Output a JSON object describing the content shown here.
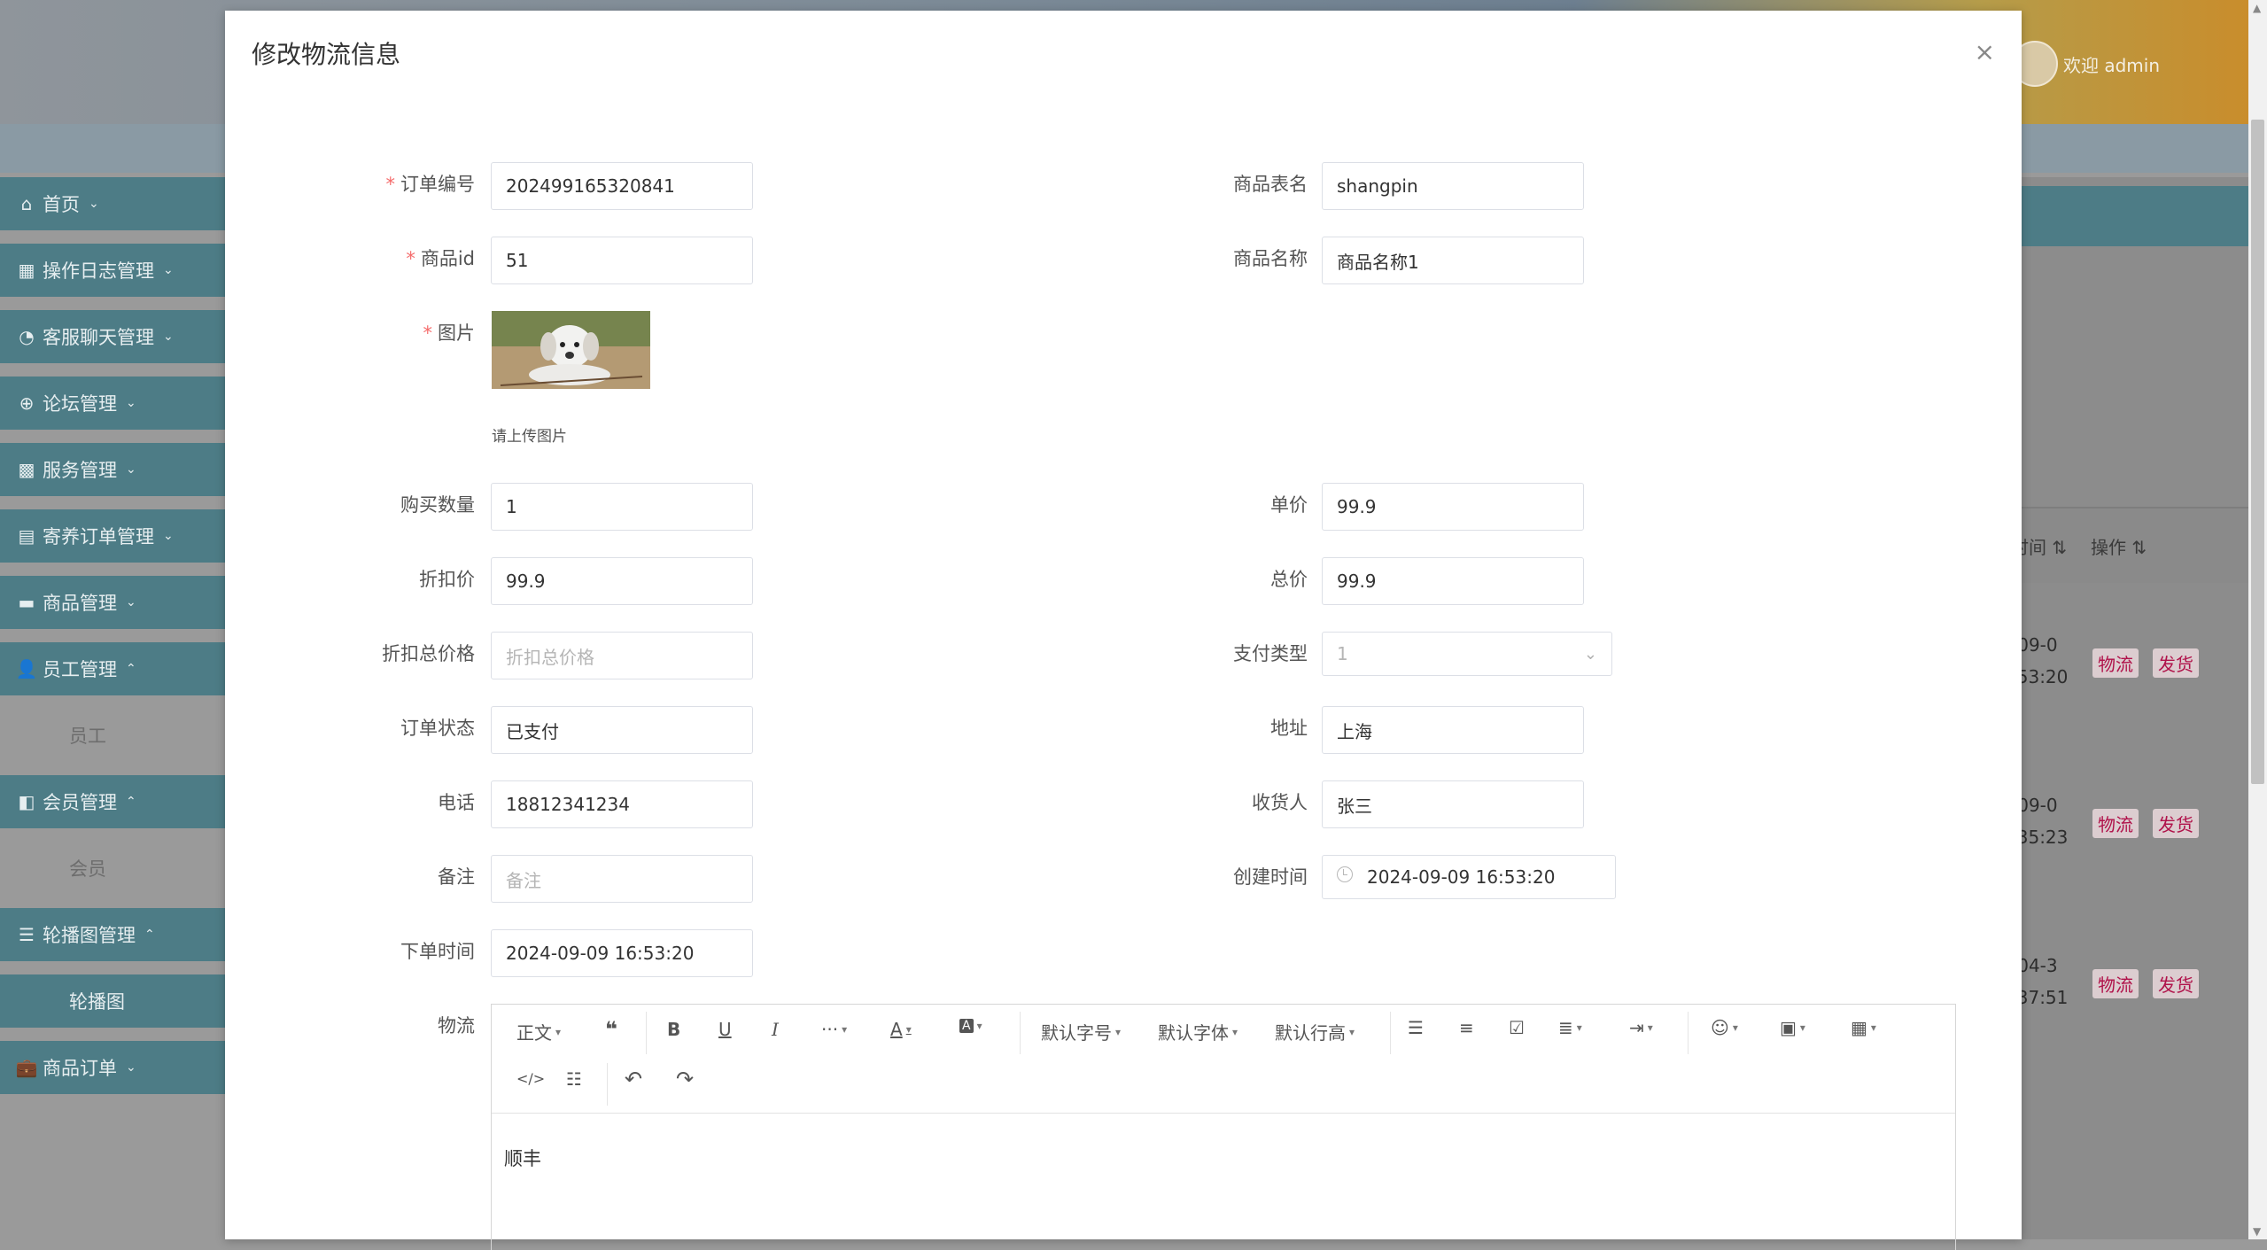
{
  "header": {
    "welcome": "欢迎 admin"
  },
  "sidebar": {
    "items": [
      {
        "label": "首页",
        "icon": "home-icon",
        "chev": "⌄"
      },
      {
        "label": "操作日志管理",
        "icon": "grid-icon",
        "chev": "⌄"
      },
      {
        "label": "客服聊天管理",
        "icon": "pie-icon",
        "chev": "⌄"
      },
      {
        "label": "论坛管理",
        "icon": "plus-circle-icon",
        "chev": "⌄"
      },
      {
        "label": "服务管理",
        "icon": "blocks-icon",
        "chev": "⌄"
      },
      {
        "label": "寄养订单管理",
        "icon": "dashboard-icon",
        "chev": "⌄"
      },
      {
        "label": "商品管理",
        "icon": "card-icon",
        "chev": "⌄"
      },
      {
        "label": "员工管理",
        "icon": "user-icon",
        "chev": "⌃"
      },
      {
        "label": "员工",
        "sub": true
      },
      {
        "label": "会员管理",
        "icon": "panel-icon",
        "chev": "⌃"
      },
      {
        "label": "会员",
        "sub": true
      },
      {
        "label": "轮播图管理",
        "icon": "list-icon",
        "chev": "⌃"
      },
      {
        "label": "轮播图",
        "sub": true,
        "active": true
      },
      {
        "label": "商品订单",
        "icon": "briefcase-icon",
        "chev": "⌄"
      }
    ]
  },
  "right_table": {
    "col_time": "时间",
    "col_op": "操作",
    "rows": [
      {
        "t1": "-09-0",
        "t2": ":53:20"
      },
      {
        "t1": "-09-0",
        "t2": ":35:23"
      },
      {
        "t1": "-04-3",
        "t2": ":37:51"
      }
    ],
    "tag_logistics": "物流",
    "tag_ship": "发货"
  },
  "modal": {
    "title": "修改物流信息",
    "close": "×",
    "fields": {
      "order_no": {
        "label": "订单编号",
        "value": "202499165320841"
      },
      "goods_table": {
        "label": "商品表名",
        "value": "shangpin"
      },
      "goods_id": {
        "label": "商品id",
        "value": "51"
      },
      "goods_name": {
        "label": "商品名称",
        "value": "商品名称1"
      },
      "image": {
        "label": "图片",
        "hint": "请上传图片"
      },
      "quantity": {
        "label": "购买数量",
        "value": "1"
      },
      "unit_price": {
        "label": "单价",
        "value": "99.9"
      },
      "discount_price": {
        "label": "折扣价",
        "value": "99.9"
      },
      "total_price": {
        "label": "总价",
        "value": "99.9"
      },
      "discount_total": {
        "label": "折扣总价格",
        "placeholder": "折扣总价格"
      },
      "pay_type": {
        "label": "支付类型",
        "value": "1"
      },
      "order_status": {
        "label": "订单状态",
        "value": "已支付"
      },
      "address": {
        "label": "地址",
        "value": "上海"
      },
      "phone": {
        "label": "电话",
        "value": "18812341234"
      },
      "receiver": {
        "label": "收货人",
        "value": "张三"
      },
      "remark": {
        "label": "备注",
        "placeholder": "备注"
      },
      "create_time": {
        "label": "创建时间",
        "value": "2024-09-09 16:53:20"
      },
      "order_time": {
        "label": "下单时间",
        "value": "2024-09-09 16:53:20"
      },
      "logistics": {
        "label": "物流",
        "content": "顺丰"
      }
    },
    "editor_toolbar": {
      "paragraph": "正文",
      "font_size": "默认字号",
      "font_family": "默认字体",
      "line_height": "默认行高"
    }
  }
}
